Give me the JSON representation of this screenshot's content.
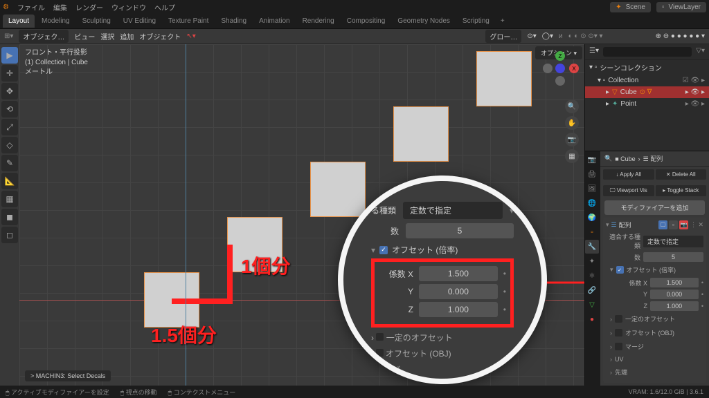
{
  "top_menu": {
    "file": "ファイル",
    "edit": "編集",
    "render": "レンダー",
    "window": "ウィンドウ",
    "help": "ヘルプ"
  },
  "scene": {
    "label": "Scene",
    "viewlayer": "ViewLayer"
  },
  "workspaces": {
    "layout": "Layout",
    "modeling": "Modeling",
    "sculpting": "Sculpting",
    "uv": "UV Editing",
    "texture": "Texture Paint",
    "shading": "Shading",
    "animation": "Animation",
    "rendering": "Rendering",
    "compositing": "Compositing",
    "geo": "Geometry Nodes",
    "scripting": "Scripting"
  },
  "header": {
    "mode": "オブジェク…",
    "view": "ビュー",
    "select": "選択",
    "add": "追加",
    "object": "オブジェクト",
    "global": "グロー…",
    "options": "オプション ▾"
  },
  "viewport": {
    "line1": "フロント・平行投影",
    "line2": "(1) Collection | Cube",
    "line3": "メートル",
    "machin3": "> MACHIN3: Select Decals"
  },
  "annotations": {
    "one": "1個分",
    "onehalf": "1.5個分"
  },
  "magnify": {
    "fit_type_label": "る種類",
    "fit_type": "定数で指定",
    "count_label": "数",
    "count": "5",
    "offset_header": "オフセット (倍率)",
    "factor_x_label": "係数 X",
    "factor_x": "1.500",
    "y_label": "Y",
    "y": "0.000",
    "z_label": "Z",
    "z": "1.000",
    "const_offset": "一定のオフセット",
    "obj_offset": "オフセット (OBJ)",
    "merge": "マージ"
  },
  "outliner": {
    "search_placeholder": "",
    "scene_coll": "シーンコレクション",
    "collection": "Collection",
    "cube": "Cube",
    "point": "Point"
  },
  "props": {
    "breadcrumb_cube": "Cube",
    "breadcrumb_array": "配列",
    "apply_all": "Apply All",
    "delete_all": "Delete All",
    "viewport_vis": "Viewport Vis",
    "toggle_stack": "Toggle Stack",
    "add_modifier": "モディファイアーを追加",
    "mod_name": "配列",
    "fit_type_label": "適合する種類",
    "fit_type": "定数で指定",
    "count_label": "数",
    "count": "5",
    "offset_header": "オフセット (倍率)",
    "factor_x_label": "係数 X",
    "factor_x": "1.500",
    "y_label": "Y",
    "y": "0.000",
    "z_label": "Z",
    "z": "1.000",
    "const_offset": "一定のオフセット",
    "obj_offset": "オフセット (OBJ)",
    "merge": "マージ",
    "uv": "UV",
    "cap": "先端"
  },
  "statusbar": {
    "set_modifier": "アクティブモディファイアーを設定",
    "view_move": "視点の移動",
    "context_menu": "コンテクストメニュー",
    "vram": "VRAM: 1.6/12.0 GiB | 3.6.1"
  }
}
